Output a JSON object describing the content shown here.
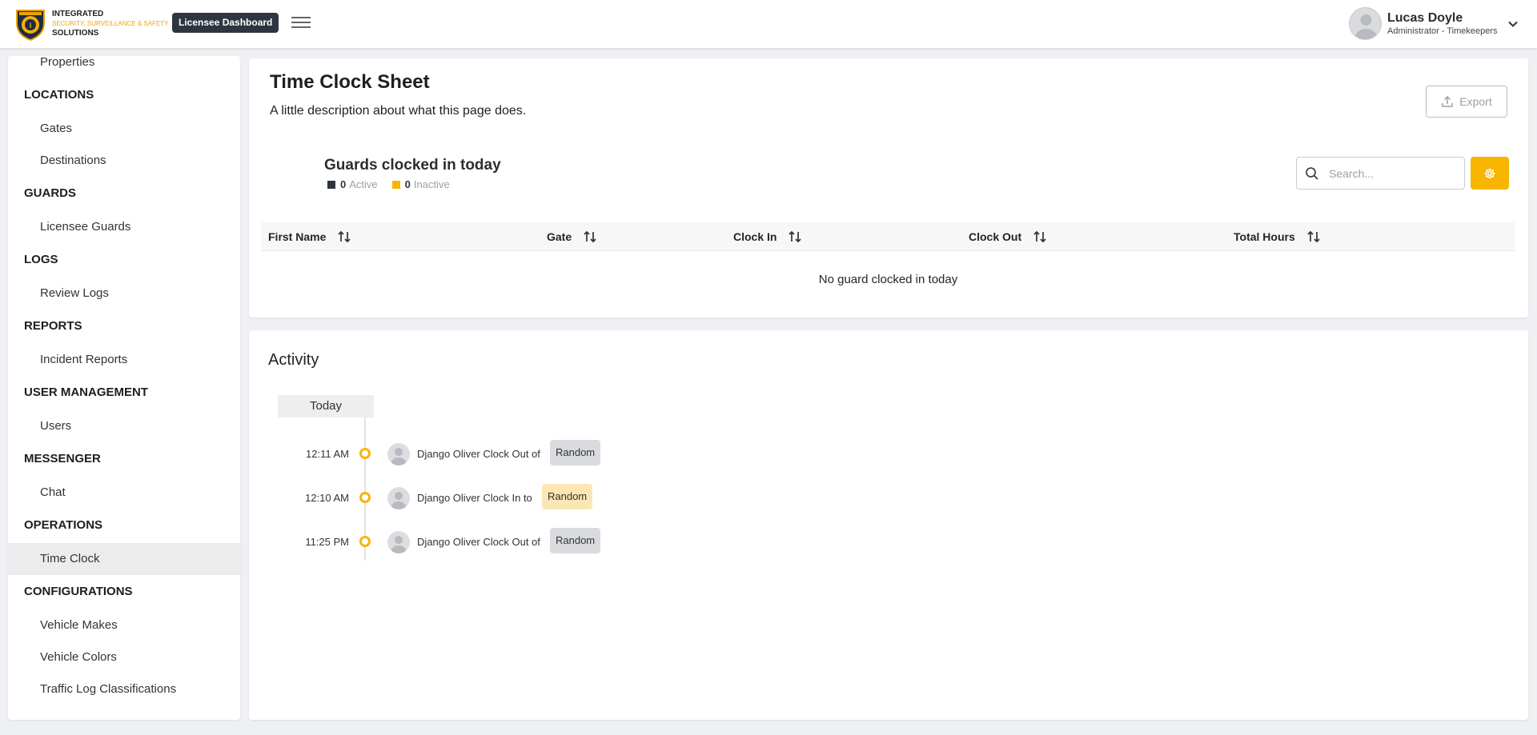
{
  "header": {
    "logo_top_text": "INTEGRATED",
    "logo_mid_text": "SECURITY, SURVEILLANCE & SAFETY",
    "logo_bottom_text": "SOLUTIONS",
    "dashboard_chip": "Licensee Dashboard",
    "menu_icon": "hamburger-icon",
    "user": {
      "name": "Lucas Doyle",
      "role": "Administrator - Timekeepers"
    }
  },
  "sidebar": {
    "partial_item": "Properties",
    "sections": [
      {
        "title": "LOCATIONS",
        "items": [
          "Gates",
          "Destinations"
        ]
      },
      {
        "title": "GUARDS",
        "items": [
          "Licensee Guards"
        ]
      },
      {
        "title": "LOGS",
        "items": [
          "Review Logs"
        ]
      },
      {
        "title": "REPORTS",
        "items": [
          "Incident Reports"
        ]
      },
      {
        "title": "USER MANAGEMENT",
        "items": [
          "Users"
        ]
      },
      {
        "title": "MESSENGER",
        "items": [
          "Chat"
        ]
      },
      {
        "title": "OPERATIONS",
        "items": [
          "Time Clock"
        ]
      },
      {
        "title": "CONFIGURATIONS",
        "items": [
          "Vehicle Makes",
          "Vehicle Colors",
          "Traffic Log Classifications"
        ]
      }
    ],
    "active_item": "Time Clock"
  },
  "page": {
    "title": "Time Clock Sheet",
    "description": "A little description about what this page does.",
    "export_label": "Export"
  },
  "guards": {
    "title": "Guards clocked in today",
    "active_count": "0",
    "active_label": "Active",
    "inactive_count": "0",
    "inactive_label": "Inactive",
    "search_placeholder": "Search..."
  },
  "table": {
    "columns": [
      "First Name",
      "Gate",
      "Clock In",
      "Clock Out",
      "Total Hours"
    ],
    "empty_text": "No guard clocked in today"
  },
  "activity": {
    "title": "Activity",
    "day_label": "Today",
    "entries": [
      {
        "time": "12:11 AM",
        "text": "Django Oliver Clock Out of",
        "tag": "Random",
        "tag_style": "gray"
      },
      {
        "time": "12:10 AM",
        "text": "Django Oliver Clock In to",
        "tag": "Random",
        "tag_style": "yellow"
      },
      {
        "time": "11:25 PM",
        "text": "Django Oliver Clock Out of",
        "tag": "Random",
        "tag_style": "gray"
      }
    ]
  },
  "colors": {
    "accent": "#f7b500",
    "dark": "#2f3540",
    "active_legend": "#2f3540",
    "inactive_legend": "#f7b500"
  }
}
